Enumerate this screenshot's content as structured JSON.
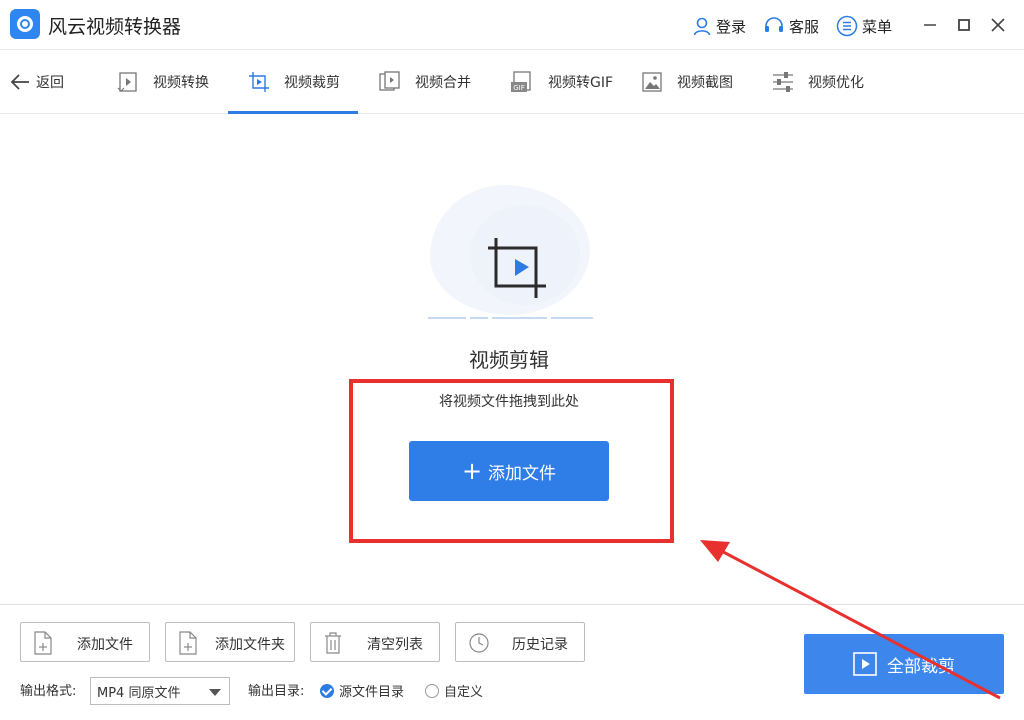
{
  "app": {
    "title": "风云视频转换器"
  },
  "titlebar": {
    "login": "登录",
    "service": "客服",
    "menu": "菜单"
  },
  "nav": {
    "back": "返回",
    "tabs": [
      {
        "label": "视频转换",
        "icon": "video-convert-icon"
      },
      {
        "label": "视频裁剪",
        "icon": "video-crop-icon",
        "active": true
      },
      {
        "label": "视频合并",
        "icon": "video-merge-icon"
      },
      {
        "label": "视频转GIF",
        "icon": "gif-icon"
      },
      {
        "label": "视频截图",
        "icon": "screenshot-icon"
      },
      {
        "label": "视频优化",
        "icon": "sliders-icon"
      }
    ]
  },
  "drop": {
    "title": "视频剪辑",
    "hint": "将视频文件拖拽到此处",
    "add_button": "添加文件",
    "add_plus": "+"
  },
  "bottom": {
    "buttons": [
      {
        "label": "添加文件",
        "icon": "add-file-icon"
      },
      {
        "label": "添加文件夹",
        "icon": "add-folder-icon"
      },
      {
        "label": "清空列表",
        "icon": "trash-icon"
      },
      {
        "label": "历史记录",
        "icon": "clock-icon"
      }
    ],
    "format_label": "输出格式:",
    "format_value": "MP4 同原文件",
    "dir_label": "输出目录:",
    "dir_options": [
      {
        "label": "源文件目录",
        "checked": true
      },
      {
        "label": "自定义",
        "checked": false
      }
    ],
    "start_all": "全部裁剪"
  },
  "colors": {
    "accent": "#2f7de6",
    "annotation_red": "#e8302f"
  }
}
